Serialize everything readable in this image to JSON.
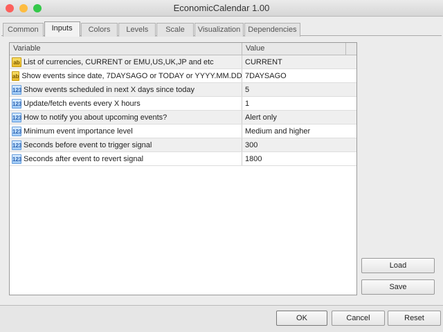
{
  "window": {
    "title": "EconomicCalendar 1.00"
  },
  "tabs": [
    {
      "label": "Common"
    },
    {
      "label": "Inputs"
    },
    {
      "label": "Colors"
    },
    {
      "label": "Levels"
    },
    {
      "label": "Scale"
    },
    {
      "label": "Visualization"
    },
    {
      "label": "Dependencies"
    }
  ],
  "table": {
    "headers": {
      "variable": "Variable",
      "value": "Value"
    },
    "rows": [
      {
        "type": "ab",
        "variable": "List of currencies, CURRENT or EMU,US,UK,JP and etc",
        "value": "CURRENT"
      },
      {
        "type": "ab",
        "variable": "Show events since date, 7DAYSAGO or TODAY or YYYY.MM.DD",
        "value": "7DAYSAGO"
      },
      {
        "type": "123",
        "variable": "Show events scheduled in next X days since today",
        "value": "5"
      },
      {
        "type": "123",
        "variable": "Update/fetch events every X hours",
        "value": "1"
      },
      {
        "type": "123",
        "variable": "How to notify you about upcoming events?",
        "value": "Alert only"
      },
      {
        "type": "123",
        "variable": "Minimum event importance level",
        "value": "Medium and higher"
      },
      {
        "type": "123",
        "variable": "Seconds before event to trigger signal",
        "value": "300"
      },
      {
        "type": "123",
        "variable": "Seconds after event to revert signal",
        "value": "1800"
      }
    ]
  },
  "buttons": {
    "load": "Load",
    "save": "Save",
    "ok": "OK",
    "cancel": "Cancel",
    "reset": "Reset"
  },
  "icons": {
    "ab": "ab",
    "num": "123"
  }
}
